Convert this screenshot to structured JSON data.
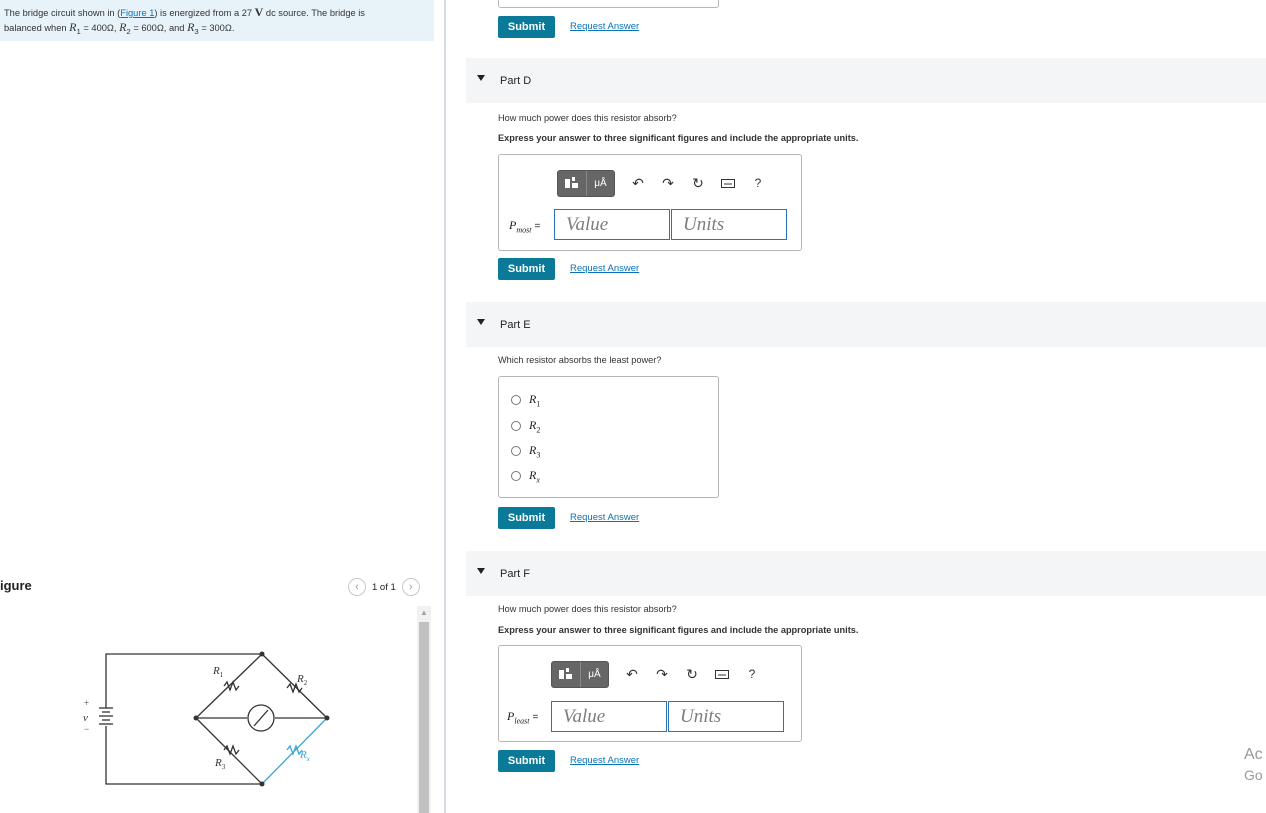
{
  "problem": {
    "text_1": "The bridge circuit shown in (",
    "figure_link": "Figure 1",
    "text_2": ") is energized from a 27",
    "unit_v": "V",
    "text_3": "dc source. The bridge is",
    "text_4": "balanced when",
    "r1": "R",
    "r1_sub": "1",
    "r1_val": "= 400",
    "r2": "R",
    "r2_sub": "2",
    "r2_val": "= 600",
    "text_and": ", and",
    "r3": "R",
    "r3_sub": "3",
    "r3_val": "= 300",
    "ohm": "Ω",
    "period": "."
  },
  "figure": {
    "title": "igure",
    "counter": "1 of 1",
    "prev_icon": "chevron-left-icon",
    "next_icon": "chevron-right-icon",
    "labels": {
      "r1": "R",
      "r1_sub": "1",
      "r2": "R",
      "r2_sub": "2",
      "r3": "R",
      "r3_sub": "3",
      "rx": "R",
      "rx_sub": "x",
      "v": "v",
      "plus": "+",
      "minus": "−"
    }
  },
  "parts": {
    "top": {
      "submit": "Submit",
      "request": "Request Answer"
    },
    "d": {
      "title": "Part D",
      "question": "How much power does this resistor absorb?",
      "instruction": "Express your answer to three significant figures and include the appropriate units.",
      "label_main": "P",
      "label_sub": "most",
      "equals": "=",
      "value_placeholder": "Value",
      "units_placeholder": "Units",
      "submit": "Submit",
      "request": "Request Answer"
    },
    "e": {
      "title": "Part E",
      "question": "Which resistor absorbs the least power?",
      "options": [
        {
          "main": "R",
          "sub": "1"
        },
        {
          "main": "R",
          "sub": "2"
        },
        {
          "main": "R",
          "sub": "3"
        },
        {
          "main": "R",
          "sub": "x"
        }
      ],
      "submit": "Submit",
      "request": "Request Answer"
    },
    "f": {
      "title": "Part F",
      "question": "How much power does this resistor absorb?",
      "instruction": "Express your answer to three significant figures and include the appropriate units.",
      "label_main": "P",
      "label_sub": "least",
      "equals": "=",
      "value_placeholder": "Value",
      "units_placeholder": "Units",
      "submit": "Submit",
      "request": "Request Answer"
    }
  },
  "toolbar": {
    "micro": "μÅ",
    "help": "?",
    "icons": [
      "template-icon",
      "units-icon",
      "undo-icon",
      "redo-icon",
      "reset-icon",
      "keyboard-icon",
      "help-icon"
    ]
  },
  "watermark": {
    "line1": "Ac",
    "line2": "Go"
  },
  "colors": {
    "accent": "#0a7a98",
    "link": "#0b72b5",
    "problem_bg": "#e7f3f8",
    "rx_line": "#3aa6d8"
  }
}
